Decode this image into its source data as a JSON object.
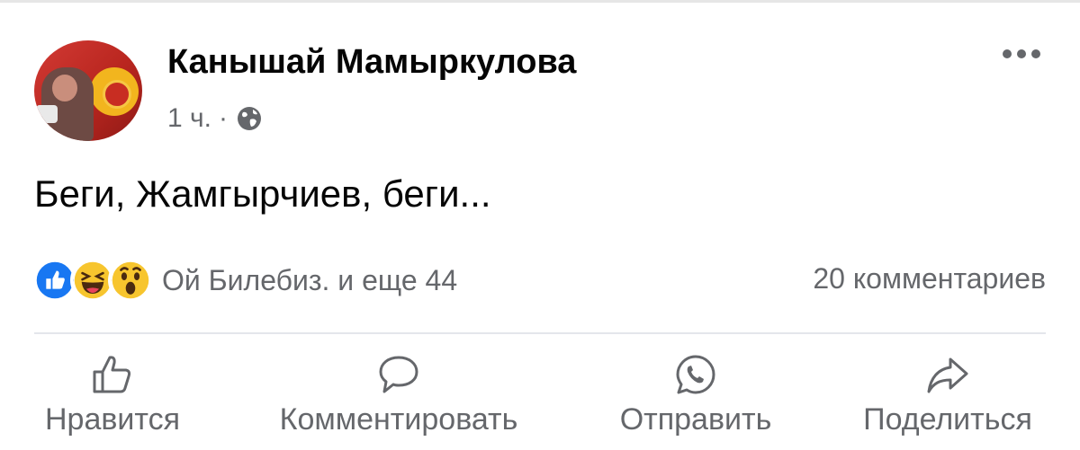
{
  "post": {
    "author": "Канышай Мамыркулова",
    "time": "1 ч.",
    "separator": "·",
    "text": "Беги, Жамгырчиев, беги..."
  },
  "reactions": {
    "summary": "Ой Билебиз. и еще 44",
    "types": [
      "like-icon",
      "haha-icon",
      "wow-icon"
    ]
  },
  "comments_count": "20 комментариев",
  "actions": {
    "like": "Нравится",
    "comment": "Комментировать",
    "send": "Отправить",
    "share": "Поделиться"
  },
  "colors": {
    "text": "#050505",
    "secondary": "#65676b",
    "like_blue": "#1877f2",
    "emoji_yellow": "#f7c52e"
  }
}
